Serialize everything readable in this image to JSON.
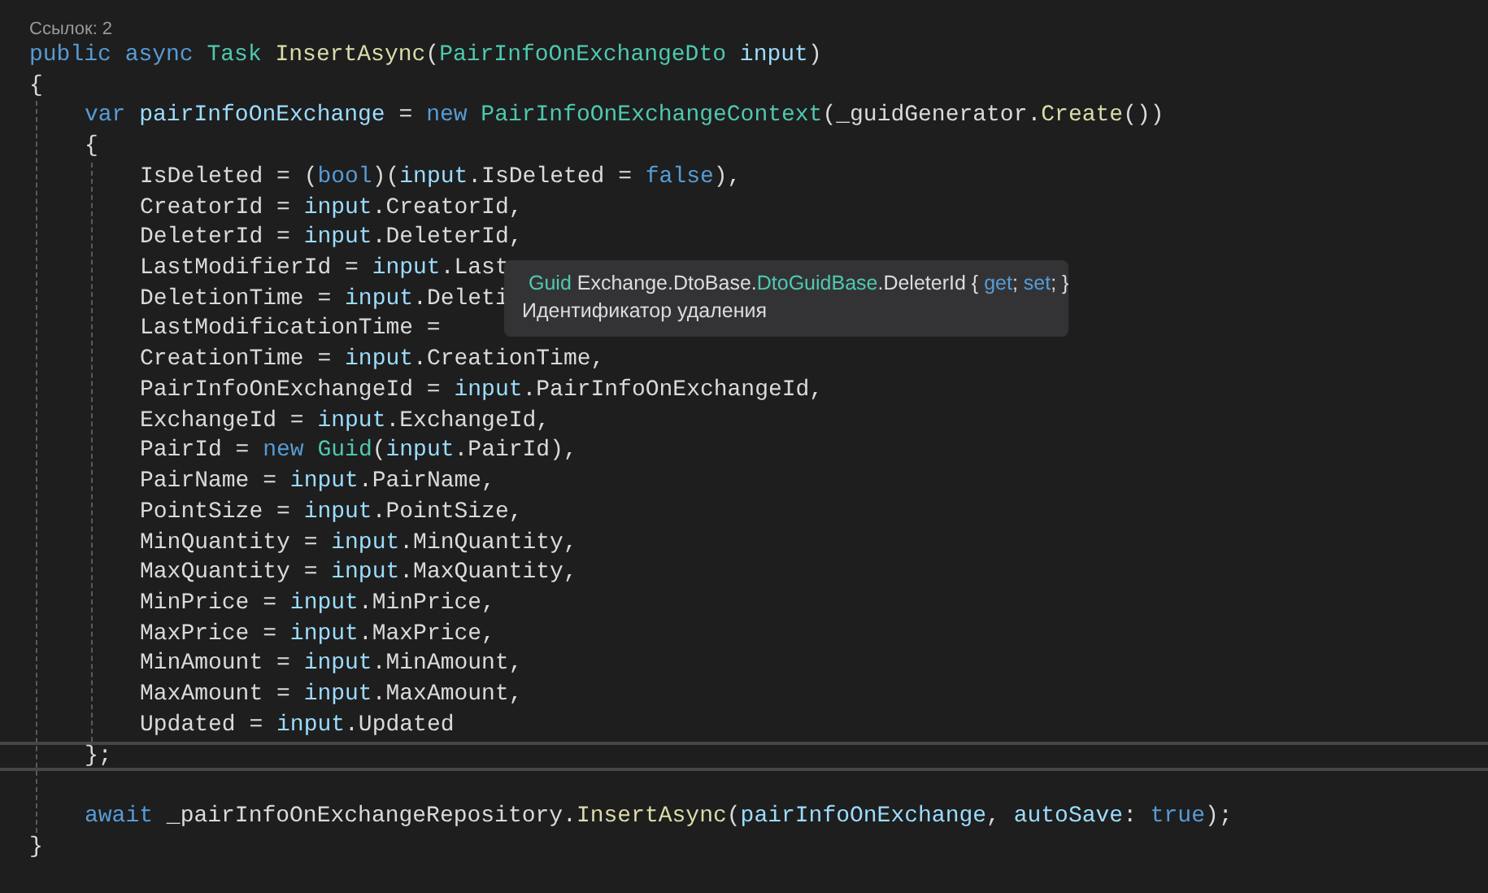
{
  "codelens": "Ссылок: 2",
  "code": [
    {
      "tokens": [
        {
          "keyword": "public "
        },
        {
          "keyword": "async "
        },
        {
          "type": "Task "
        },
        {
          "method": "InsertAsync"
        },
        {
          "plain": "("
        },
        {
          "type": "PairInfoOnExchangeDto "
        },
        {
          "variable": "input"
        },
        {
          "plain": ")"
        }
      ]
    },
    {
      "tokens": [
        {
          "plain": "{"
        }
      ],
      "children": [
        {
          "tokens": [
            {
              "keyword": "var "
            },
            {
              "variable": "pairInfoOnExchange"
            },
            {
              "plain": " = "
            },
            {
              "keyword": "new "
            },
            {
              "type": "PairInfoOnExchangeContext"
            },
            {
              "plain": "(_guidGenerator."
            },
            {
              "method": "Create"
            },
            {
              "plain": "())"
            }
          ]
        },
        {
          "tokens": [
            {
              "plain": "{"
            }
          ],
          "children": [
            {
              "tokens": [
                {
                  "plain": "IsDeleted = ("
                },
                {
                  "keyword": "bool"
                },
                {
                  "plain": ")("
                },
                {
                  "variable": "input"
                },
                {
                  "plain": ".IsDeleted = "
                },
                {
                  "keyword": "false"
                },
                {
                  "plain": "),"
                }
              ]
            },
            {
              "tokens": [
                {
                  "plain": "CreatorId = "
                },
                {
                  "variable": "input"
                },
                {
                  "plain": ".CreatorId,"
                }
              ]
            },
            {
              "tokens": [
                {
                  "plain": "DeleterId = "
                },
                {
                  "variable": "input"
                },
                {
                  "plain": ".DeleterId,"
                }
              ]
            },
            {
              "tokens": [
                {
                  "plain": "LastModifierId = "
                },
                {
                  "variable": "input"
                },
                {
                  "plain": ".Last"
                }
              ]
            },
            {
              "tokens": [
                {
                  "plain": "DeletionTime = "
                },
                {
                  "variable": "input"
                },
                {
                  "plain": ".Deleti"
                }
              ]
            },
            {
              "tokens": [
                {
                  "plain": "LastModificationTime ="
                }
              ]
            },
            {
              "tokens": [
                {
                  "plain": "CreationTime = "
                },
                {
                  "variable": "input"
                },
                {
                  "plain": ".CreationTime,"
                }
              ]
            },
            {
              "tokens": [
                {
                  "plain": "PairInfoOnExchangeId = "
                },
                {
                  "variable": "input"
                },
                {
                  "plain": ".PairInfoOnExchangeId,"
                }
              ]
            },
            {
              "tokens": [
                {
                  "plain": "ExchangeId = "
                },
                {
                  "variable": "input"
                },
                {
                  "plain": ".ExchangeId,"
                }
              ]
            },
            {
              "tokens": [
                {
                  "plain": "PairId = "
                },
                {
                  "keyword": "new "
                },
                {
                  "type": "Guid"
                },
                {
                  "plain": "("
                },
                {
                  "variable": "input"
                },
                {
                  "plain": ".PairId),"
                }
              ]
            },
            {
              "tokens": [
                {
                  "plain": "PairName = "
                },
                {
                  "variable": "input"
                },
                {
                  "plain": ".PairName,"
                }
              ]
            },
            {
              "tokens": [
                {
                  "plain": "PointSize = "
                },
                {
                  "variable": "input"
                },
                {
                  "plain": ".PointSize,"
                }
              ]
            },
            {
              "tokens": [
                {
                  "plain": "MinQuantity = "
                },
                {
                  "variable": "input"
                },
                {
                  "plain": ".MinQuantity,"
                }
              ]
            },
            {
              "tokens": [
                {
                  "plain": "MaxQuantity = "
                },
                {
                  "variable": "input"
                },
                {
                  "plain": ".MaxQuantity,"
                }
              ]
            },
            {
              "tokens": [
                {
                  "plain": "MinPrice = "
                },
                {
                  "variable": "input"
                },
                {
                  "plain": ".MinPrice,"
                }
              ]
            },
            {
              "tokens": [
                {
                  "plain": "MaxPrice = "
                },
                {
                  "variable": "input"
                },
                {
                  "plain": ".MaxPrice,"
                }
              ]
            },
            {
              "tokens": [
                {
                  "plain": "MinAmount = "
                },
                {
                  "variable": "input"
                },
                {
                  "plain": ".MinAmount,"
                }
              ]
            },
            {
              "tokens": [
                {
                  "plain": "MaxAmount = "
                },
                {
                  "variable": "input"
                },
                {
                  "plain": ".MaxAmount,"
                }
              ]
            },
            {
              "tokens": [
                {
                  "plain": "Updated = "
                },
                {
                  "variable": "input"
                },
                {
                  "plain": ".Updated"
                }
              ]
            }
          ]
        },
        {
          "current": true,
          "tokens": [
            {
              "plain": "};"
            }
          ]
        },
        {
          "gap_before": true,
          "tokens": [
            {
              "keyword": "await"
            },
            {
              "plain": " _pairInfoOnExchangeRepository."
            },
            {
              "method": "InsertAsync"
            },
            {
              "plain": "("
            },
            {
              "variable": "pairInfoOnExchange"
            },
            {
              "plain": ", "
            },
            {
              "variable": "autoSave"
            },
            {
              "plain": ": "
            },
            {
              "keyword": "true"
            },
            {
              "plain": ");"
            }
          ]
        }
      ]
    },
    {
      "tokens": [
        {
          "plain": "}"
        }
      ]
    }
  ],
  "tooltip": {
    "signature": [
      {
        "type": "Guid"
      },
      {
        "plain": " Exchange.DtoBase."
      },
      {
        "type": "DtoGuidBase"
      },
      {
        "plain": ".DeleterId { "
      },
      {
        "keyword": "get"
      },
      {
        "plain": "; "
      },
      {
        "keyword": "set"
      },
      {
        "plain": "; }"
      }
    ],
    "description": "Идентификатор удаления"
  }
}
